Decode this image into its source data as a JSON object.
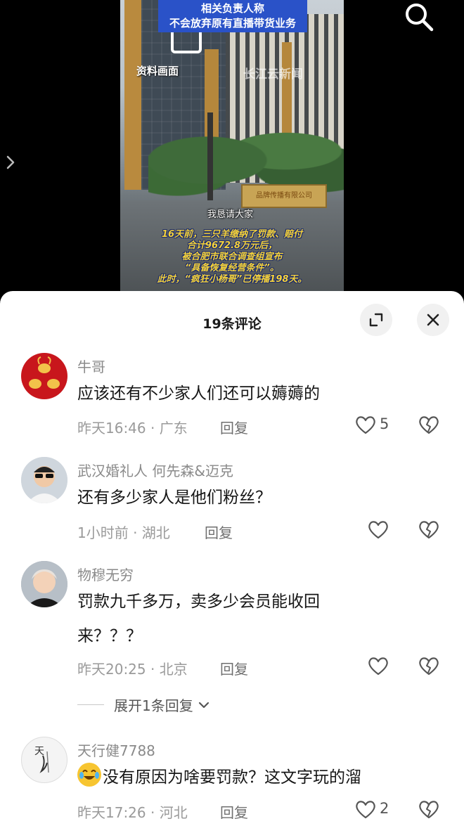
{
  "video": {
    "headline_line1": "相关负责人称",
    "headline_line2": "不会放弃原有直播带货业务",
    "watermark_left": "资料画面",
    "watermark_right": "长江云新闻",
    "subtitle": "我恳请大家",
    "caption": [
      "16天前，三只羊缴纳了罚款、赔付",
      "合计9672.8万元后，",
      "被合肥市联合调查组宣布",
      "“具备恢复经营条件”。",
      "此时，“疯狂小杨哥”已停播198天。"
    ],
    "gate_sign": "品牌传播有限公司"
  },
  "sheet": {
    "title": "19条评论"
  },
  "comments": [
    {
      "user": "牛哥",
      "text": "应该还有不少家人们还可以薅薅的",
      "meta": "昨天16:46 · 广东",
      "reply": "回复",
      "likes": "5",
      "avatar": "golden-goats"
    },
    {
      "user": "武汉婚礼人  何先森&迈克",
      "text": "还有多少家人是他们粉丝？",
      "meta": "1小时前 · 湖北",
      "reply": "回复",
      "likes": "",
      "avatar": "man-sunglasses"
    },
    {
      "user": "物穆无穷",
      "text": "罚款九千多万，卖多少会员能收回来？？？",
      "meta": "昨天20:25 · 北京",
      "reply": "回复",
      "likes": "",
      "avatar": "man-portrait"
    },
    {
      "user": "天行健7788",
      "text": "没有原因为啥要罚款？这文字玩的溜",
      "meta": "昨天17:26 · 河北",
      "reply": "回复",
      "likes": "2",
      "avatar": "calligraphy",
      "emoji": "laughing-crying-emoji"
    }
  ],
  "expand_replies": "展开1条回复",
  "colors": {
    "headline_bg": "#2a52c8",
    "caption_text": "#f5d23a",
    "sheet_bg": "#ffffff",
    "meta_gray": "#9a9a9a"
  }
}
